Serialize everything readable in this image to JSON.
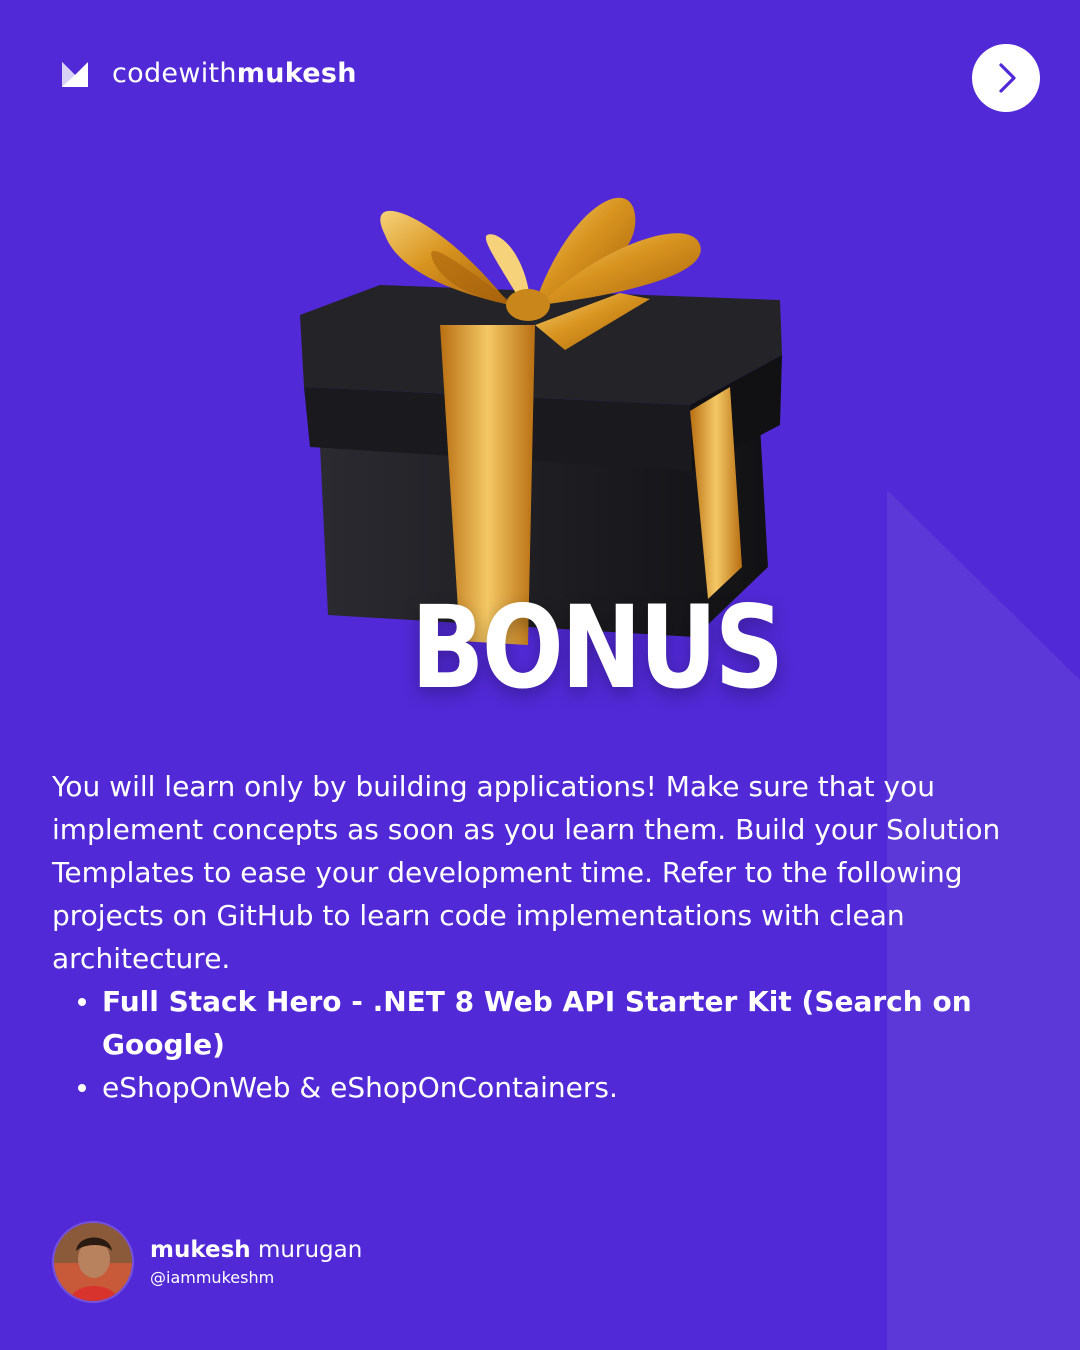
{
  "brand": {
    "name_light": "codewith",
    "name_bold": "mukesh"
  },
  "colors": {
    "background": "#5129d6",
    "accent_gold": "#e0a23a",
    "box_black": "#1c1c20",
    "text": "#ffffff"
  },
  "icons": {
    "logo": "m-logo-icon",
    "next": "chevron-right-icon",
    "gift": "gift-box-illustration"
  },
  "title": "BONUS",
  "body": "You will learn only by building applications! Make sure that you implement concepts as soon as you learn them. Build your Solution Templates to ease your development time. Refer to the following projects on GitHub to learn code implementations with clean architecture.",
  "bullets": [
    {
      "text": "Full Stack Hero - .NET 8 Web API Starter Kit (Search on Google)",
      "bold": true
    },
    {
      "text": "eShopOnWeb & eShopOnContainers.",
      "bold": false
    }
  ],
  "author": {
    "first_name": "mukesh",
    "last_name": "murugan",
    "handle": "@iammukeshm"
  }
}
